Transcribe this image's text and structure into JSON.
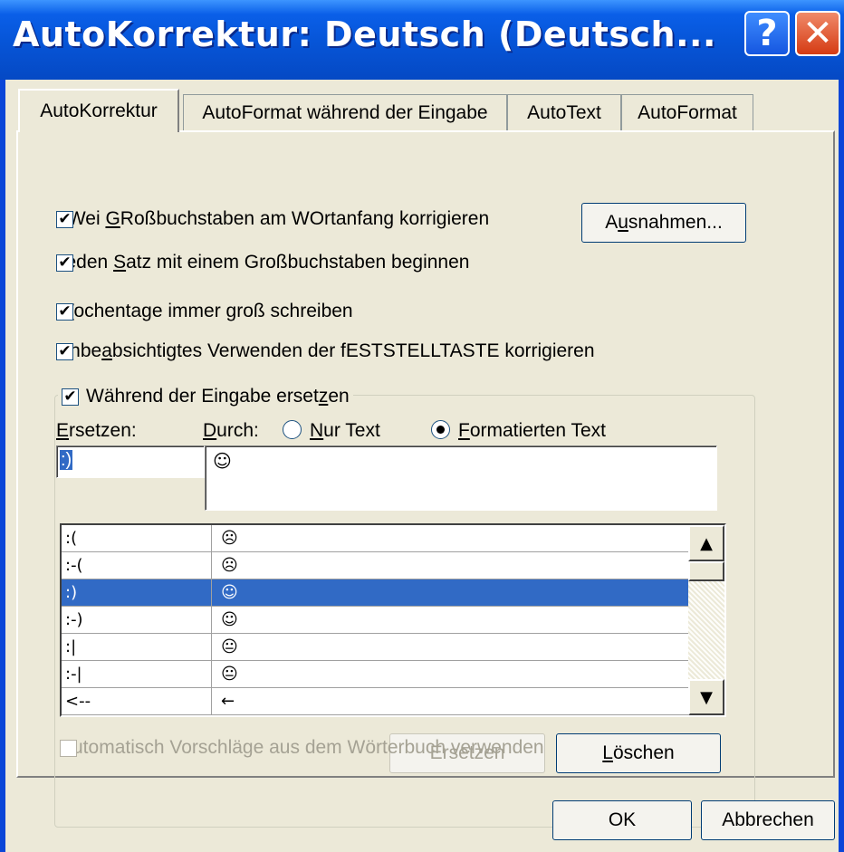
{
  "window": {
    "title": "AutoKorrektur: Deutsch (Deutsch...",
    "help_label": "?",
    "close_label": "✕"
  },
  "tabs": [
    {
      "label": "AutoKorrektur",
      "active": true
    },
    {
      "label": "AutoFormat während der Eingabe",
      "active": false
    },
    {
      "label": "AutoText",
      "active": false
    },
    {
      "label": "AutoFormat",
      "active": false
    }
  ],
  "options": {
    "two_caps": {
      "pre": "ZWei ",
      "key": "G",
      "post": "Roßbuchstaben am WOrtanfang korrigieren",
      "checked": "✔"
    },
    "sentence_caps": {
      "pre": "Jeden ",
      "key": "S",
      "post": "atz mit einem Großbuchstaben beginnen",
      "checked": "✔"
    },
    "weekdays": {
      "pre": "",
      "key": "W",
      "post": "ochentage immer groß schreiben",
      "checked": "✔"
    },
    "capslock": {
      "pre": "Unbe",
      "key": "a",
      "post": "bsichtigtes Verwenden der fESTSTELLTASTE korrigieren",
      "checked": "✔"
    }
  },
  "exceptions_button": {
    "pre": "A",
    "key": "u",
    "post": "snahmen..."
  },
  "replace_group": {
    "caption_pre": "Während der Eingabe erset",
    "caption_key": "z",
    "caption_post": "en",
    "checked": "✔",
    "replace_label_key": "E",
    "replace_label_post": "rsetzen:",
    "with_label_key": "D",
    "with_label_post": "urch:",
    "radio_plain_key": "N",
    "radio_plain_post": "ur Text",
    "radio_formatted_key": "F",
    "radio_formatted_post": "ormatierten Text",
    "selected_radio": "formatted",
    "replace_value": ":)",
    "with_value": "☺"
  },
  "entries": [
    {
      "from": ":(",
      "to": "☹"
    },
    {
      "from": ":-(",
      "to": "☹"
    },
    {
      "from": ":)",
      "to": "☺",
      "selected": true
    },
    {
      "from": ":-)",
      "to": "☺"
    },
    {
      "from": ":|",
      "to": "😐"
    },
    {
      "from": ":-|",
      "to": "😐"
    },
    {
      "from": "<--",
      "to": "←"
    }
  ],
  "scroll": {
    "up_icon": "▲",
    "down_icon": "▼"
  },
  "buttons": {
    "replace": "Ersetzen",
    "delete_key": "L",
    "delete_post": "öschen",
    "ok": "OK",
    "cancel": "Abbrechen"
  },
  "suggestions": {
    "label": "Automatisch Vorschläge aus dem Wörterbuch verwenden",
    "checked": ""
  }
}
